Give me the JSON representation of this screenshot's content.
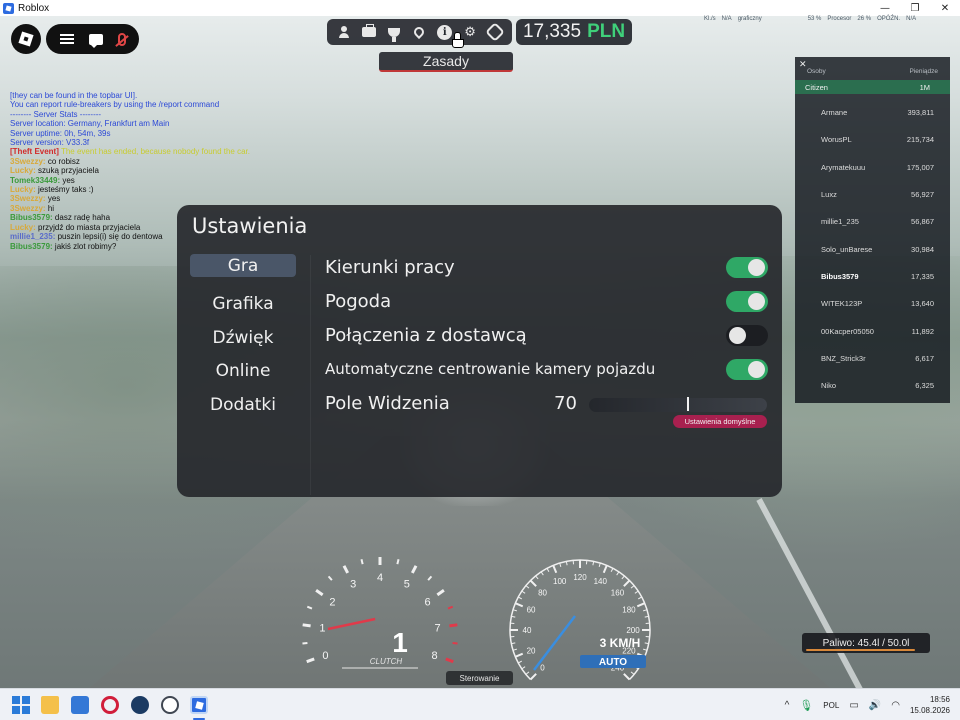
{
  "window": {
    "title": "Roblox",
    "min": "—",
    "max": "❐",
    "close": "✕"
  },
  "performance": {
    "items": [
      "Kl./s",
      "N/A",
      "graficzny",
      "53 %",
      "Procesor",
      "26 %",
      "OPÓŹN.",
      "N/A"
    ]
  },
  "top_toolbar": {
    "money_amount": "17,335",
    "money_currency": "PLN",
    "rules_label": "Zasady",
    "gear_color": "#3fd07a"
  },
  "chat": {
    "lines": [
      {
        "name": "",
        "text": "[they can be found in the topbar UI].",
        "color": "#2c49d6"
      },
      {
        "name": "",
        "text": "You can report rule-breakers by using the /report command",
        "color": "#2c49d6"
      },
      {
        "name": "",
        "text": "-------- Server Stats --------",
        "color": "#2c49d6"
      },
      {
        "name": "",
        "text": "Server location: Germany, Frankfurt am Main",
        "color": "#2c49d6"
      },
      {
        "name": "",
        "text": "Server uptime: 0h, 54m, 39s",
        "color": "#2c49d6"
      },
      {
        "name": "",
        "text": "Server version: V33.3f",
        "color": "#2c49d6"
      },
      {
        "name": "[Theft Event]",
        "text": "The event has ended, because nobody found the car.",
        "color": "#c8cc30",
        "name_color": "#d12a2a"
      },
      {
        "name": "3Swezzy:",
        "text": "co robisz",
        "color": "#111",
        "name_color": "#d8a93a"
      },
      {
        "name": "Lucky:",
        "text": "szuką przyjaciela",
        "color": "#111",
        "name_color": "#d8a93a"
      },
      {
        "name": "Tomek33449:",
        "text": "yes",
        "color": "#111",
        "name_color": "#3a9a3a"
      },
      {
        "name": "Lucky:",
        "text": "jesteśmy taks :)",
        "color": "#111",
        "name_color": "#d8a93a"
      },
      {
        "name": "3Swezzy:",
        "text": "yes",
        "color": "#111",
        "name_color": "#d8a93a"
      },
      {
        "name": "3Swezzy:",
        "text": "hi",
        "color": "#111",
        "name_color": "#d8a93a"
      },
      {
        "name": "Bibus3579:",
        "text": "dasz radę haha",
        "color": "#111",
        "name_color": "#3a9a3a"
      },
      {
        "name": "Lucky:",
        "text": "przyjdź do miasta przyjaciela",
        "color": "#111",
        "name_color": "#d8a93a"
      },
      {
        "name": "millie1_235:",
        "text": "puszin lepsi(i) się do dentowa",
        "color": "#111",
        "name_color": "#5a6cc9"
      },
      {
        "name": "Bibus3579:",
        "text": "jakiś zlot robimy?",
        "color": "#111",
        "name_color": "#3a9a3a"
      }
    ]
  },
  "leaderboard": {
    "close": "✕",
    "col_people": "Osoby",
    "col_money": "Pieniądze",
    "team_name": "Citizen",
    "team_value": "1M",
    "team_color": "#2b6e4f",
    "rows": [
      {
        "name": "Armane",
        "value": "393,811"
      },
      {
        "name": "WorusPL",
        "value": "215,734"
      },
      {
        "name": "Arymatekuuu",
        "value": "175,007"
      },
      {
        "name": "Luxz",
        "value": "56,927"
      },
      {
        "name": "millie1_235",
        "value": "56,867"
      },
      {
        "name": "Solo_unBarese",
        "value": "30,984"
      },
      {
        "name": "Bibus3579",
        "value": "17,335"
      },
      {
        "name": "WITEK123P",
        "value": "13,640"
      },
      {
        "name": "00Kacper05050",
        "value": "11,892"
      },
      {
        "name": "BNZ_Strick3r",
        "value": "6,617"
      },
      {
        "name": "Niko",
        "value": "6,325"
      }
    ]
  },
  "settings": {
    "title": "Ustawienia",
    "nav": [
      {
        "label": "Gra",
        "active": true
      },
      {
        "label": "Grafika",
        "active": false
      },
      {
        "label": "Dźwięk",
        "active": false
      },
      {
        "label": "Online",
        "active": false
      },
      {
        "label": "Dodatki",
        "active": false
      }
    ],
    "options": [
      {
        "label": "Kierunki pracy",
        "on": true
      },
      {
        "label": "Pogoda",
        "on": true
      },
      {
        "label": "Połączenia z dostawcą",
        "on": false
      },
      {
        "label": "Automatyczne centrowanie kamery pojazdu",
        "on": true
      }
    ],
    "fov_label": "Pole Widzenia",
    "fov_value": "70",
    "fov_fraction": 0.55,
    "reset_label": "Ustawienia domyślne",
    "toggle_on_color": "#2fa866",
    "reset_color": "#a8204f"
  },
  "dashboard": {
    "rpm_ticks": [
      "0",
      "1",
      "2",
      "3",
      "4",
      "5",
      "6",
      "7",
      "8"
    ],
    "gear": "1",
    "clutch_label": "CLUTCH",
    "speed_ticks": [
      "0",
      "20",
      "40",
      "60",
      "80",
      "100",
      "120",
      "140",
      "160",
      "180",
      "200",
      "220",
      "240"
    ],
    "speed_text": "3 KM/H",
    "transmission": "AUTO",
    "needle_color": "#e03a4a",
    "speed_needle_color": "#3a8ee0",
    "steering_label": "Sterowanie"
  },
  "fuel": {
    "label": "Paliwo: 45.4l / 50.0l",
    "fraction": 0.908,
    "bar_color": "#d8883a"
  },
  "taskbar": {
    "language": "POL",
    "time": "18:56",
    "date": "15.08.2026",
    "tray_chevron": "^",
    "wifi": "◠",
    "volume": "🔊",
    "battery": "▭"
  }
}
